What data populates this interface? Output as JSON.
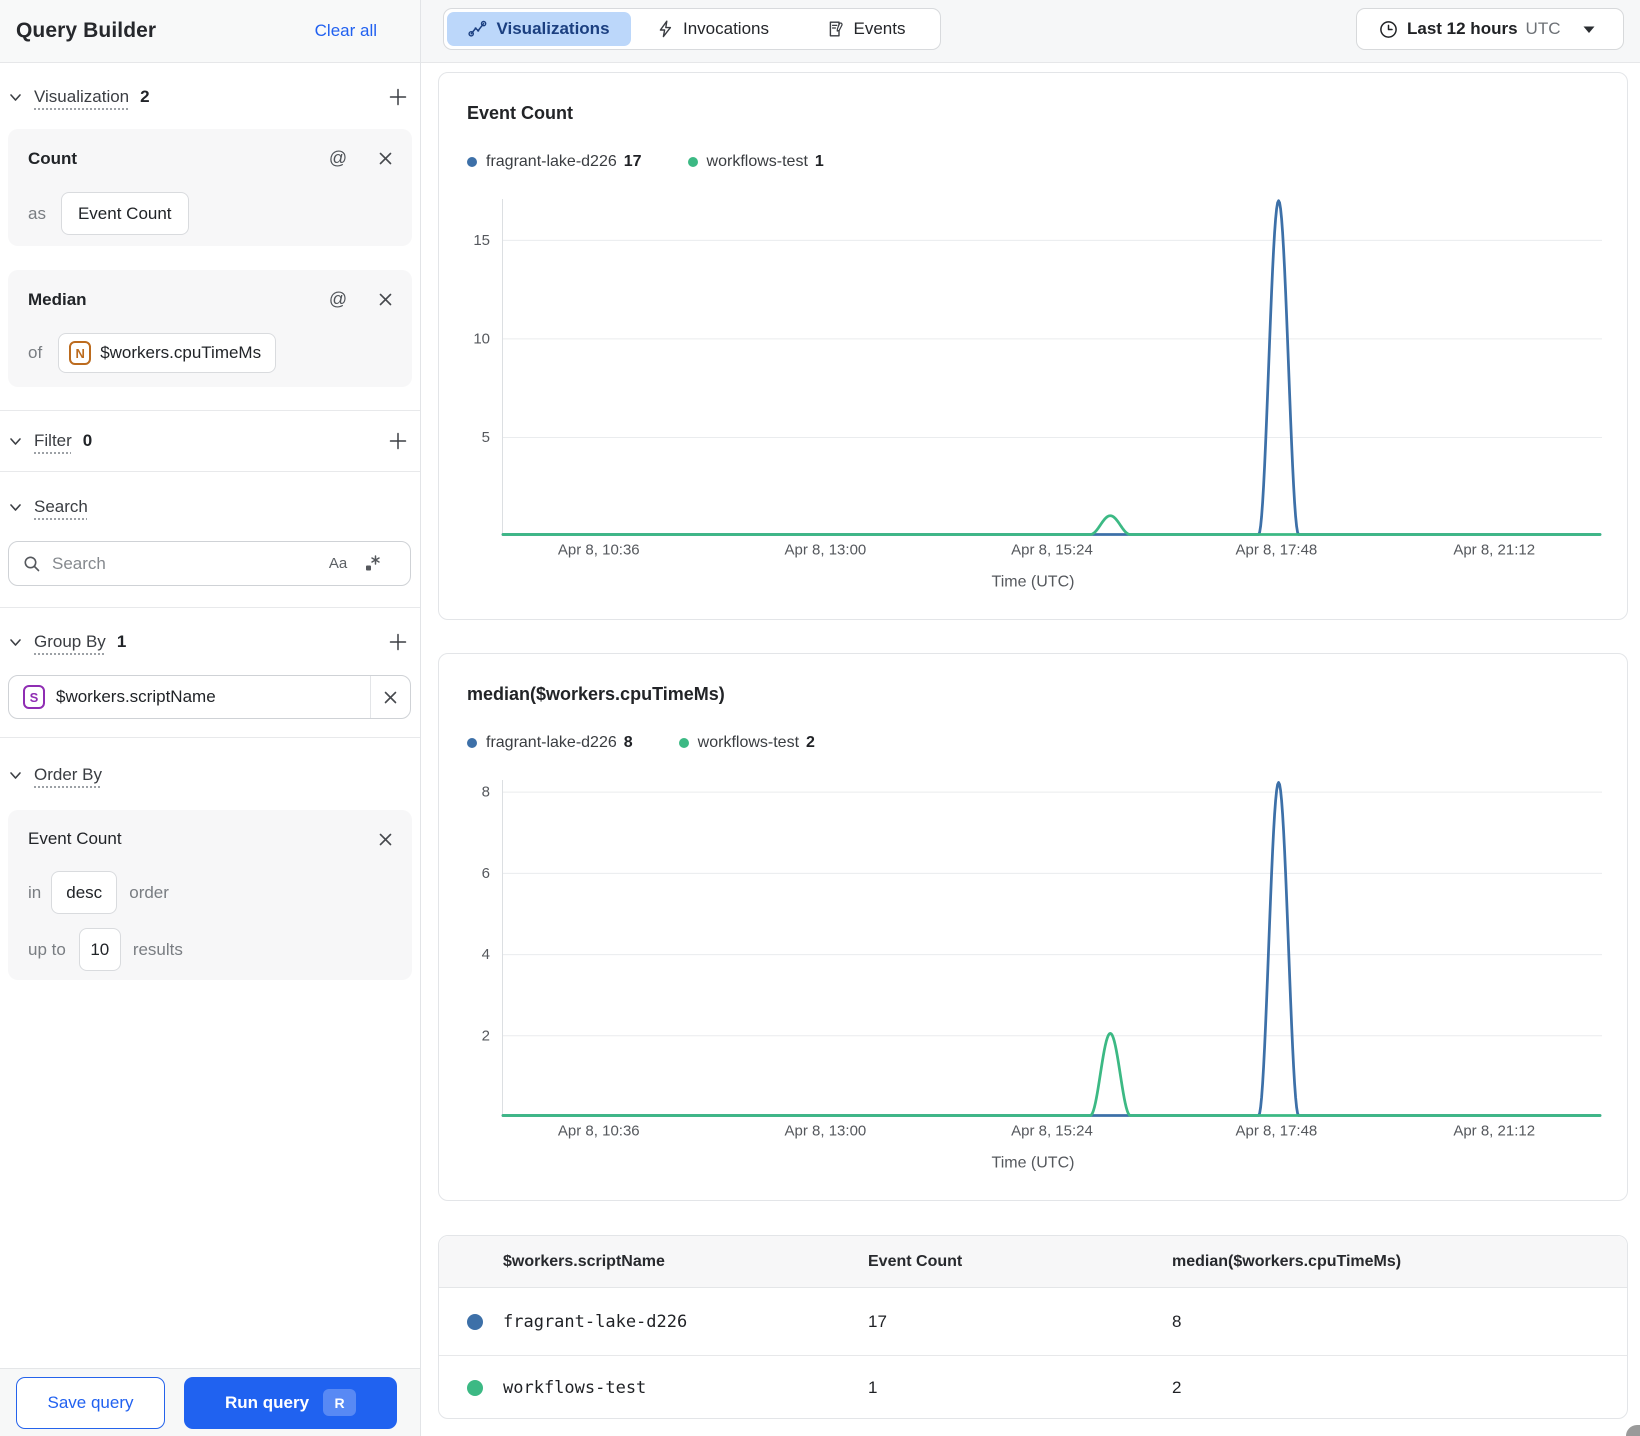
{
  "sidebar": {
    "title": "Query Builder",
    "clear_all": "Clear all",
    "sections": {
      "visualization": {
        "label": "Visualization",
        "count": "2"
      },
      "filter": {
        "label": "Filter",
        "count": "0"
      },
      "search": {
        "label": "Search"
      },
      "group_by": {
        "label": "Group By",
        "count": "1"
      },
      "order_by": {
        "label": "Order By"
      }
    },
    "aggregations": [
      {
        "title": "Count",
        "prefix": "as",
        "chip_text": "Event Count"
      },
      {
        "title": "Median",
        "prefix": "of",
        "chip_icon": "N",
        "chip_text": "$workers.cpuTimeMs"
      }
    ],
    "search": {
      "placeholder": "Search",
      "case_toggle": "Aa"
    },
    "group_by_value": {
      "icon": "S",
      "text": "$workers.scriptName"
    },
    "order_by_card": {
      "title": "Event Count",
      "in_label": "in",
      "direction": "desc",
      "order_label": "order",
      "upto_label": "up to",
      "limit": "10",
      "results_label": "results"
    },
    "footer": {
      "save_label": "Save query",
      "run_label": "Run query",
      "run_shortcut": "R"
    }
  },
  "topbar": {
    "tabs": [
      {
        "label": "Visualizations",
        "icon": "chart-line-icon",
        "active": true
      },
      {
        "label": "Invocations",
        "icon": "lightning-icon",
        "active": false
      },
      {
        "label": "Events",
        "icon": "document-icon",
        "active": false
      }
    ],
    "time_range": {
      "label": "Last 12 hours",
      "timezone": "UTC"
    }
  },
  "colors": {
    "accent_blue": "#2161f0",
    "tab_selected_bg": "#bcd7fa",
    "tab_selected_text": "#1b3f80",
    "series_blue": "#3D70A8",
    "series_green": "#3CB984",
    "gridline": "#eaecee",
    "axis_text": "#55585d"
  },
  "chart_data": [
    {
      "type": "line",
      "title": "Event Count",
      "xlabel": "Time (UTC)",
      "x_ticks": [
        {
          "label": "Apr 8, 10:36",
          "pos": 0.088
        },
        {
          "label": "Apr 8, 13:00",
          "pos": 0.294
        },
        {
          "label": "Apr 8, 15:24",
          "pos": 0.5
        },
        {
          "label": "Apr 8, 17:48",
          "pos": 0.704
        },
        {
          "label": "Apr 8, 21:12",
          "pos": 0.902
        }
      ],
      "y_ticks": [
        5,
        10,
        15
      ],
      "ylim": [
        0,
        17.1
      ],
      "grid": true,
      "legend_position": "top-left",
      "series": [
        {
          "name": "fragrant-lake-d226",
          "color": "#3D70A8",
          "legend_value": 17,
          "baseline": 0,
          "peak": {
            "pos": 0.706,
            "value": 17,
            "time": "Apr 8, 17:48"
          }
        },
        {
          "name": "workflows-test",
          "color": "#3CB984",
          "legend_value": 1,
          "baseline": 0,
          "peak": {
            "pos": 0.553,
            "value": 1,
            "time": "Apr 8, 15:50"
          }
        }
      ]
    },
    {
      "type": "line",
      "title": "median($workers.cpuTimeMs)",
      "xlabel": "Time (UTC)",
      "x_ticks": [
        {
          "label": "Apr 8, 10:36",
          "pos": 0.088
        },
        {
          "label": "Apr 8, 13:00",
          "pos": 0.294
        },
        {
          "label": "Apr 8, 15:24",
          "pos": 0.5
        },
        {
          "label": "Apr 8, 17:48",
          "pos": 0.704
        },
        {
          "label": "Apr 8, 21:12",
          "pos": 0.902
        }
      ],
      "y_ticks": [
        2,
        4,
        6,
        8
      ],
      "ylim": [
        0,
        8.3
      ],
      "grid": true,
      "legend_position": "top-left",
      "series": [
        {
          "name": "fragrant-lake-d226",
          "color": "#3D70A8",
          "legend_value": 8,
          "baseline": 0,
          "peak": {
            "pos": 0.706,
            "value": 8,
            "time": "Apr 8, 17:48"
          }
        },
        {
          "name": "workflows-test",
          "color": "#3CB984",
          "legend_value": 2,
          "baseline": 0,
          "peak": {
            "pos": 0.553,
            "value": 2,
            "time": "Apr 8, 15:50"
          }
        }
      ]
    }
  ],
  "table": {
    "columns": [
      "$workers.scriptName",
      "Event Count",
      "median($workers.cpuTimeMs)"
    ],
    "rows": [
      {
        "dot_color": "#3D70A8",
        "name": "fragrant-lake-d226",
        "values": [
          "17",
          "8"
        ]
      },
      {
        "dot_color": "#3CB984",
        "name": "workflows-test",
        "values": [
          "1",
          "2"
        ]
      }
    ]
  }
}
